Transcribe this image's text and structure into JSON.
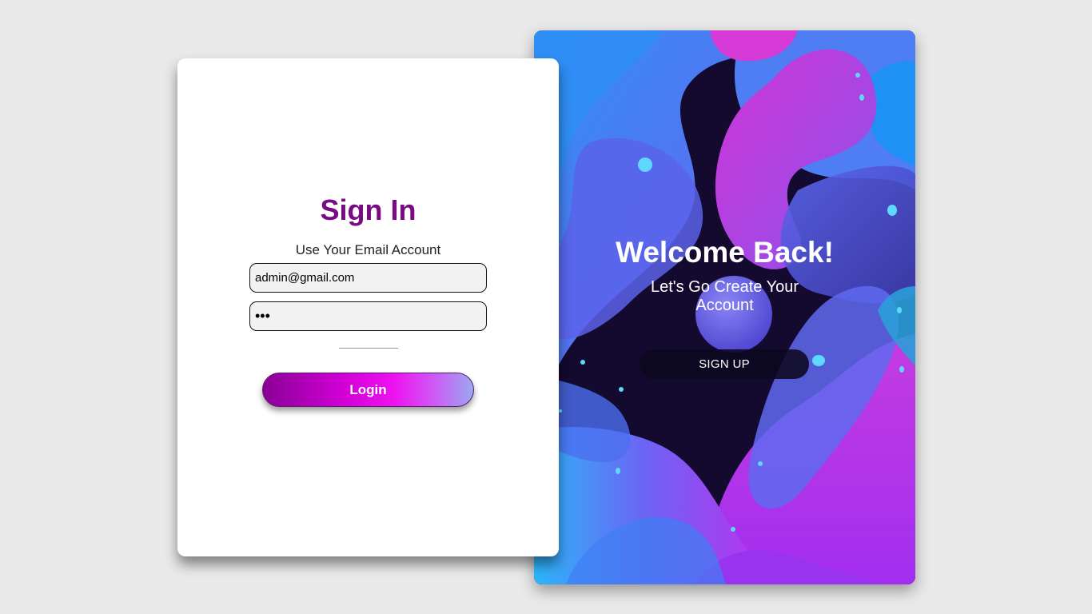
{
  "signin": {
    "title": "Sign In",
    "subtitle": "Use Your Email Account",
    "email_value": "admin@gmail.com",
    "password_value": "•••",
    "login_label": "Login"
  },
  "welcome": {
    "title": "Welcome Back!",
    "subtitle": "Let's Go Create Your Account",
    "signup_label": "SIGN UP"
  },
  "colors": {
    "page_background": "#e9e9e9",
    "title_purple": "#7a0a82",
    "login_gradient_start": "#8a0096",
    "login_gradient_mid": "#ee12f0",
    "login_gradient_end": "#9ca8f2",
    "panel_dark": "#12082e",
    "blob_blue": "#3a8cf5",
    "blob_magenta": "#c42ee0",
    "blob_cyan": "#2fb8f8"
  }
}
